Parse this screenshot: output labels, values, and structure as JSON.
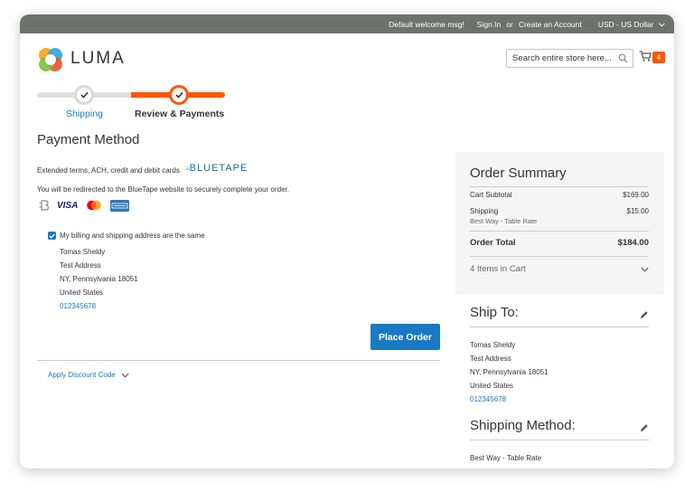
{
  "topbar": {
    "welcome": "Default welcome msg!",
    "sign_in": "Sign In",
    "or": "or",
    "create_account": "Create an Account",
    "currency": "USD - US Dollar"
  },
  "header": {
    "logo_text": "LUMA",
    "search_placeholder": "Search entire store here...",
    "cart_count": "4"
  },
  "progress": {
    "steps": [
      {
        "label": "Shipping",
        "state": "complete"
      },
      {
        "label": "Review & Payments",
        "state": "active"
      }
    ]
  },
  "payment": {
    "title": "Payment Method",
    "terms": "Extended terms, ACH, credit and debit cards",
    "brand_logo": "BLUETAPE",
    "redirect": "You will be redirected to the BlueTape website to securely complete your order.",
    "card_icons": [
      "bluetape-b-icon",
      "visa-icon",
      "mastercard-icon",
      "amex-icon"
    ],
    "visa_text": "VISA",
    "same_address_label": "My billing and shipping address are the same",
    "same_address_checked": true,
    "billing": {
      "name": "Tomas Sheldy",
      "street": "Test Address",
      "city_line": "NY, Pennsylvania 18051",
      "country": "United States",
      "phone": "012345678"
    },
    "place_order": "Place Order",
    "discount": "Apply Discount Code"
  },
  "summary": {
    "title": "Order Summary",
    "subtotal_label": "Cart Subtotal",
    "subtotal_value": "$169.00",
    "shipping_label": "Shipping",
    "shipping_value": "$15.00",
    "shipping_method": "Best Way - Table Rate",
    "total_label": "Order Total",
    "total_value": "$184.00",
    "items_in_cart": "4 Items in Cart"
  },
  "ship_to": {
    "title": "Ship To:",
    "name": "Tomas Sheldy",
    "street": "Test Address",
    "city_line": "NY, Pennsylvania 18051",
    "country": "United States",
    "phone": "012345678"
  },
  "shipping_method": {
    "title": "Shipping Method:",
    "value": "Best Way - Table Rate"
  },
  "colors": {
    "accent_blue": "#1979c3",
    "accent_orange": "#ff5501",
    "topbar": "#6e716e"
  }
}
